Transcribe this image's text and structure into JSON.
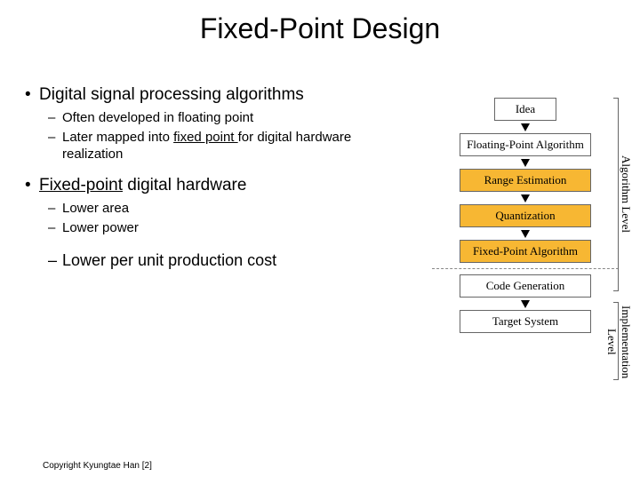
{
  "title": "Fixed-Point Design",
  "bullets": {
    "b1": "Digital signal processing algorithms",
    "b1a": "Often developed in floating point",
    "b1b_pre": "Later mapped into ",
    "b1b_link": "fixed point ",
    "b1b_post": "for digital hardware realization",
    "b2_link": "Fixed-point",
    "b2_post": " digital hardware",
    "b2a": "Lower area",
    "b2b": "Lower power",
    "b2c": "Lower per unit production cost"
  },
  "diagram": {
    "boxes": {
      "idea": "Idea",
      "fpa": "Floating-Point Algorithm",
      "range": "Range Estimation",
      "quant": "Quantization",
      "fixa": "Fixed-Point Algorithm",
      "codegen": "Code Generation",
      "target": "Target System"
    },
    "labels": {
      "algo": "Algorithm Level",
      "impl": "Implementation Level"
    }
  },
  "copyright": "Copyright Kyungtae Han [2]"
}
